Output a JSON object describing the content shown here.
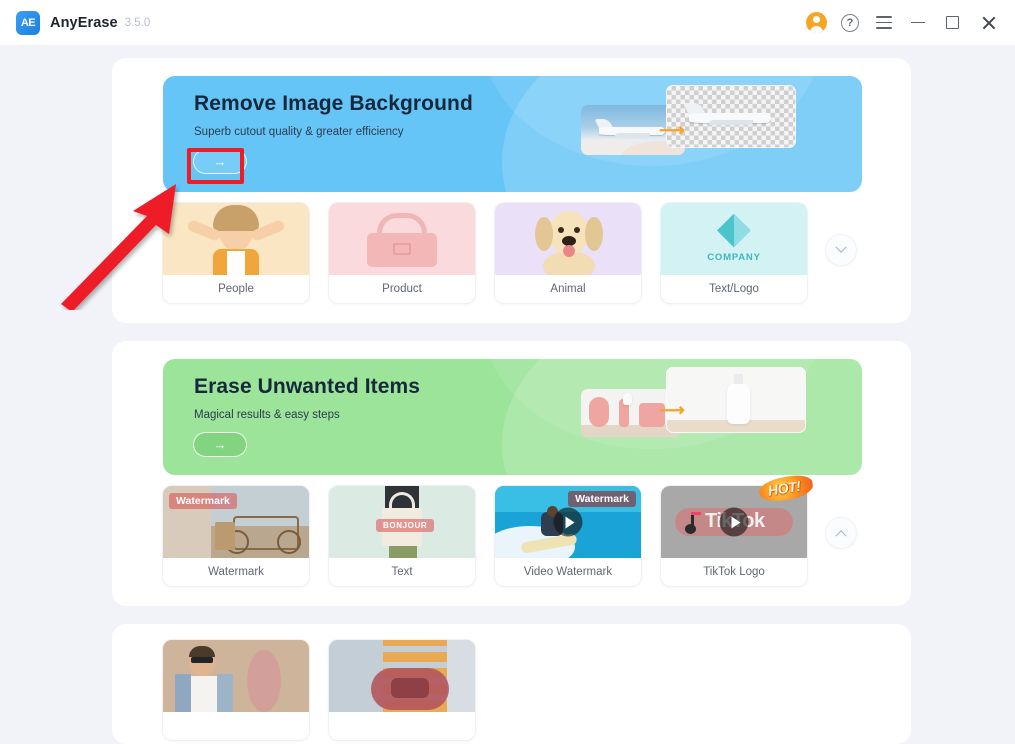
{
  "titlebar": {
    "logo_text": "AE",
    "app_name": "AnyErase",
    "version": "3.5.0",
    "icons": [
      {
        "name": "account-avatar",
        "label": "account"
      },
      {
        "name": "help-icon",
        "label": "?"
      },
      {
        "name": "menu-icon",
        "label": "menu"
      },
      {
        "name": "minimize-icon",
        "label": "minimize"
      },
      {
        "name": "maximize-icon",
        "label": "maximize"
      },
      {
        "name": "close-icon",
        "label": "close"
      }
    ]
  },
  "sections": [
    {
      "id": "remove-background",
      "banner": {
        "title": "Remove Image Background",
        "subtitle": "Superb cutout quality & greater efficiency",
        "cta_arrow": "→",
        "bg_color": "#66c5f7",
        "art": "airplane-before-after"
      },
      "cards": [
        {
          "label": "People",
          "thumb": "girl-photo",
          "thumb_bg": "#fbe6c3"
        },
        {
          "label": "Product",
          "thumb": "pink-bag",
          "thumb_bg": "#fadadd"
        },
        {
          "label": "Animal",
          "thumb": "golden-dog",
          "thumb_bg": "#eae0f8"
        },
        {
          "label": "Text/Logo",
          "thumb": "company-logo",
          "thumb_bg": "#d3f2f3",
          "logo_text": "COMPANY"
        }
      ],
      "expand_control": "chevron-down"
    },
    {
      "id": "erase-unwanted-items",
      "banner": {
        "title": "Erase Unwanted Items",
        "subtitle": "Magical results & easy steps",
        "cta_arrow": "→",
        "bg_color": "#9ce49a",
        "art": "bottle-before-after"
      },
      "cards": [
        {
          "label": "Watermark",
          "thumb": "bicycle-photo",
          "thumb_bg": "#cbb9a4",
          "overlay_text": "Watermark"
        },
        {
          "label": "Text",
          "thumb": "tote-bag",
          "thumb_bg": "#dceae4",
          "overlay_text": "BONJOUR"
        },
        {
          "label": "Video Watermark",
          "thumb": "surfer-video",
          "thumb_bg": "#2fb6e0",
          "overlay_text": "Watermark",
          "has_play": true
        },
        {
          "label": "TikTok Logo",
          "thumb": "tiktok-video",
          "thumb_bg": "#a8a8a8",
          "overlay_text": "TikTok",
          "has_play": true,
          "badge": "HOT!"
        }
      ],
      "expand_control": "chevron-up"
    },
    {
      "id": "more-tools",
      "cards": [
        {
          "label": "",
          "thumb": "man-photo",
          "thumb_bg": "#c9ae94"
        },
        {
          "label": "",
          "thumb": "car-photo",
          "thumb_bg": "#b9c6cf"
        }
      ]
    }
  ],
  "annotation": {
    "highlight_target": "remove-background-cta-button",
    "color": "#ee1c25",
    "shapes": [
      "rectangle-outline",
      "pointer-arrow"
    ]
  }
}
